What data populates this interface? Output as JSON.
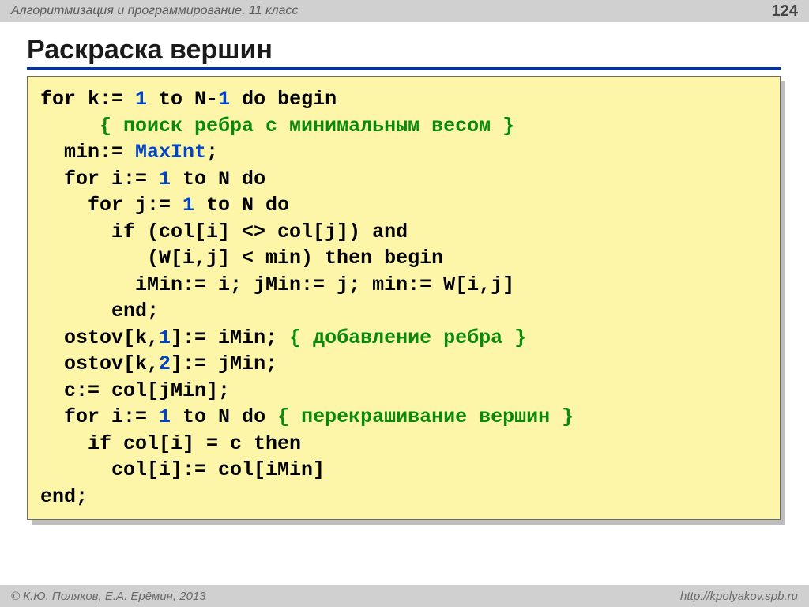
{
  "header": {
    "left": "Алгоритмизация и программирование, 11 класс",
    "page": "124"
  },
  "title": "Раскраска вершин",
  "code": {
    "l1a": "for k:= ",
    "l1b": "1",
    "l1c": " to N-",
    "l1d": "1",
    "l1e": " do begin",
    "l2a": "     ",
    "l2b": "{ поиск ребра с минимальным весом }",
    "l3a": "  min:= ",
    "l3b": "MaxInt",
    "l3c": ";",
    "l4a": "  for i:= ",
    "l4b": "1",
    "l4c": " to N do",
    "l5a": "    for j:= ",
    "l5b": "1",
    "l5c": " to N do",
    "l6": "      if (col[i] <> col[j]) and",
    "l7": "         (W[i,j] < min) then begin",
    "l8": "        iMin:= i; jMin:= j; min:= W[i,j]",
    "l9": "      end;",
    "l10a": "  ostov[k,",
    "l10b": "1",
    "l10c": "]:= iMin; ",
    "l10d": "{ добавление ребра }",
    "l11a": "  ostov[k,",
    "l11b": "2",
    "l11c": "]:= jMin;",
    "l12": "  c:= col[jMin];",
    "l13a": "  for i:= ",
    "l13b": "1",
    "l13c": " to N do ",
    "l13d": "{ перекрашивание вершин }",
    "l14": "    if col[i] = c then",
    "l15": "      col[i]:= col[iMin]",
    "l16": "end;"
  },
  "footer": {
    "left": "© К.Ю. Поляков, Е.А. Ерёмин, 2013",
    "right": "http://kpolyakov.spb.ru"
  }
}
